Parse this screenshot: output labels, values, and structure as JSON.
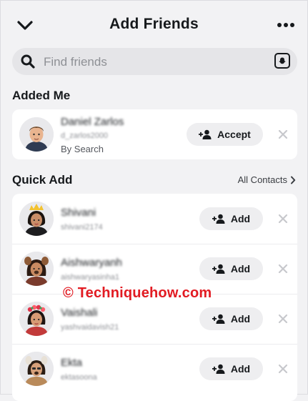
{
  "header": {
    "title": "Add Friends",
    "back_icon": "chevron-down-icon",
    "more_icon": "more-dots-icon"
  },
  "search": {
    "placeholder": "Find friends",
    "value": "",
    "icon": "search-icon",
    "scan_icon": "snapcode-icon"
  },
  "added_me": {
    "title": "Added Me",
    "items": [
      {
        "name": "Daniel Zarlos",
        "username": "d_zarlos2000",
        "subtitle": "By Search",
        "action": "Accept"
      }
    ]
  },
  "quick_add": {
    "title": "Quick Add",
    "all_contacts": "All Contacts",
    "items": [
      {
        "name": "Shivani",
        "username": "shivani2174",
        "action": "Add"
      },
      {
        "name": "Aishwaryanh",
        "username": "aishwaryasinha1",
        "action": "Add"
      },
      {
        "name": "Vaishali",
        "username": "yashvaidavish21",
        "action": "Add"
      },
      {
        "name": "Ekta",
        "username": "ektasoona",
        "action": "Add"
      }
    ]
  },
  "watermark": "© Techniquehow.com",
  "colors": {
    "background": "#f2f2f4",
    "card": "#ffffff",
    "pill": "#eeeef0",
    "watermark": "#e21b22"
  }
}
